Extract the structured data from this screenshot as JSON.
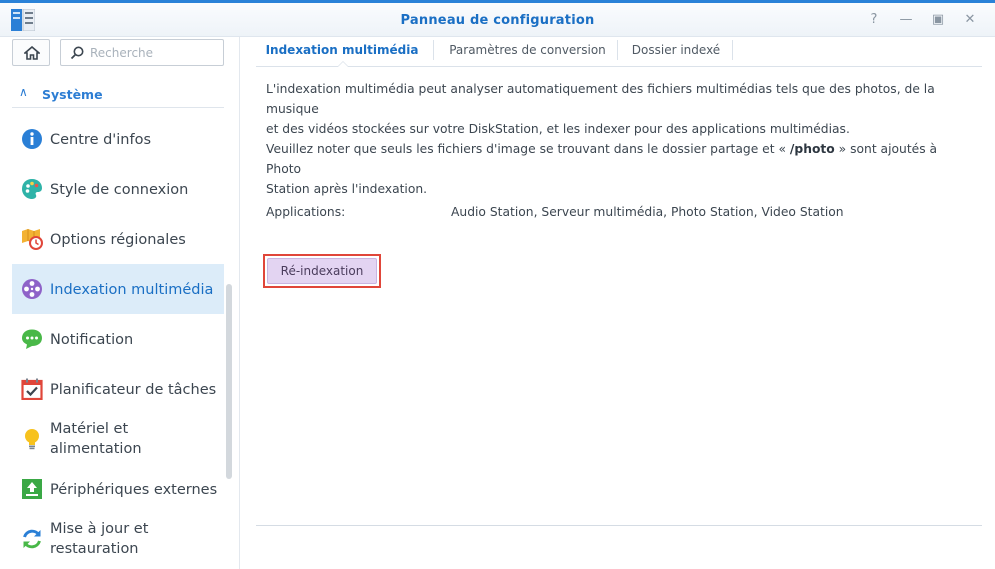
{
  "window": {
    "title": "Panneau de configuration",
    "buttons": {
      "help": "?",
      "minimize": "—",
      "maximize": "▣",
      "close": "✕"
    }
  },
  "sidebar": {
    "search_placeholder": "Recherche",
    "section": {
      "label": "Système",
      "expanded": true
    },
    "items": [
      {
        "label": "Centre d'infos",
        "icon": "info-icon",
        "active": false
      },
      {
        "label": "Style de connexion",
        "icon": "palette-icon",
        "active": false
      },
      {
        "label": "Options régionales",
        "icon": "map-clock-icon",
        "active": false
      },
      {
        "label": "Indexation multimédia",
        "icon": "film-reel-icon",
        "active": true
      },
      {
        "label": "Notification",
        "icon": "chat-bubble-icon",
        "active": false
      },
      {
        "label": "Planificateur de tâches",
        "icon": "calendar-check-icon",
        "active": false
      },
      {
        "label_line1": "Matériel et",
        "label_line2": "alimentation",
        "icon": "lightbulb-icon",
        "active": false
      },
      {
        "label": "Périphériques externes",
        "icon": "upload-device-icon",
        "active": false
      },
      {
        "label_line1": "Mise à jour et",
        "label_line2": "restauration",
        "icon": "refresh-icon",
        "active": false
      }
    ]
  },
  "tabs": [
    {
      "label": "Indexation multimédia",
      "active": true
    },
    {
      "label": "Paramètres de conversion",
      "active": false
    },
    {
      "label": "Dossier indexé",
      "active": false
    }
  ],
  "content": {
    "para1_line1": "L'indexation multimédia peut analyser automatiquement des fichiers multimédias tels que des photos, de la musique",
    "para1_line2": "et des vidéos stockées sur votre DiskStation, et les indexer pour des applications multimédias.",
    "para2_part1": "Veuillez noter que seuls les fichiers d'image se trouvant dans le dossier partage et « ",
    "para2_bold": "/photo",
    "para2_part2": " » sont ajoutés à Photo",
    "para2_line2": "Station après l'indexation.",
    "applications_label": "Applications:",
    "applications_value": "Audio Station, Serveur multimédia, Photo Station, Video Station",
    "reindex_button": "Ré-indexation"
  },
  "colors": {
    "accent": "#1a6fc4",
    "highlight": "#dcecf9",
    "button_bg": "#e3d4f2",
    "annotation_box": "#e0463a"
  }
}
